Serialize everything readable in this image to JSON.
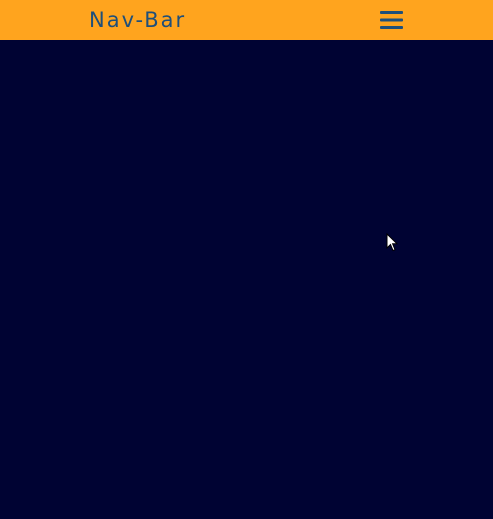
{
  "navbar": {
    "brand": "Nav-Bar",
    "menu_icon": "hamburger-menu-icon"
  },
  "colors": {
    "navbar_background": "#ffa41e",
    "brand_text": "#1f4f7a",
    "menu_icon": "#1f4f7a",
    "page_background": "#000333"
  },
  "cursor_icon": "mouse-pointer-icon"
}
